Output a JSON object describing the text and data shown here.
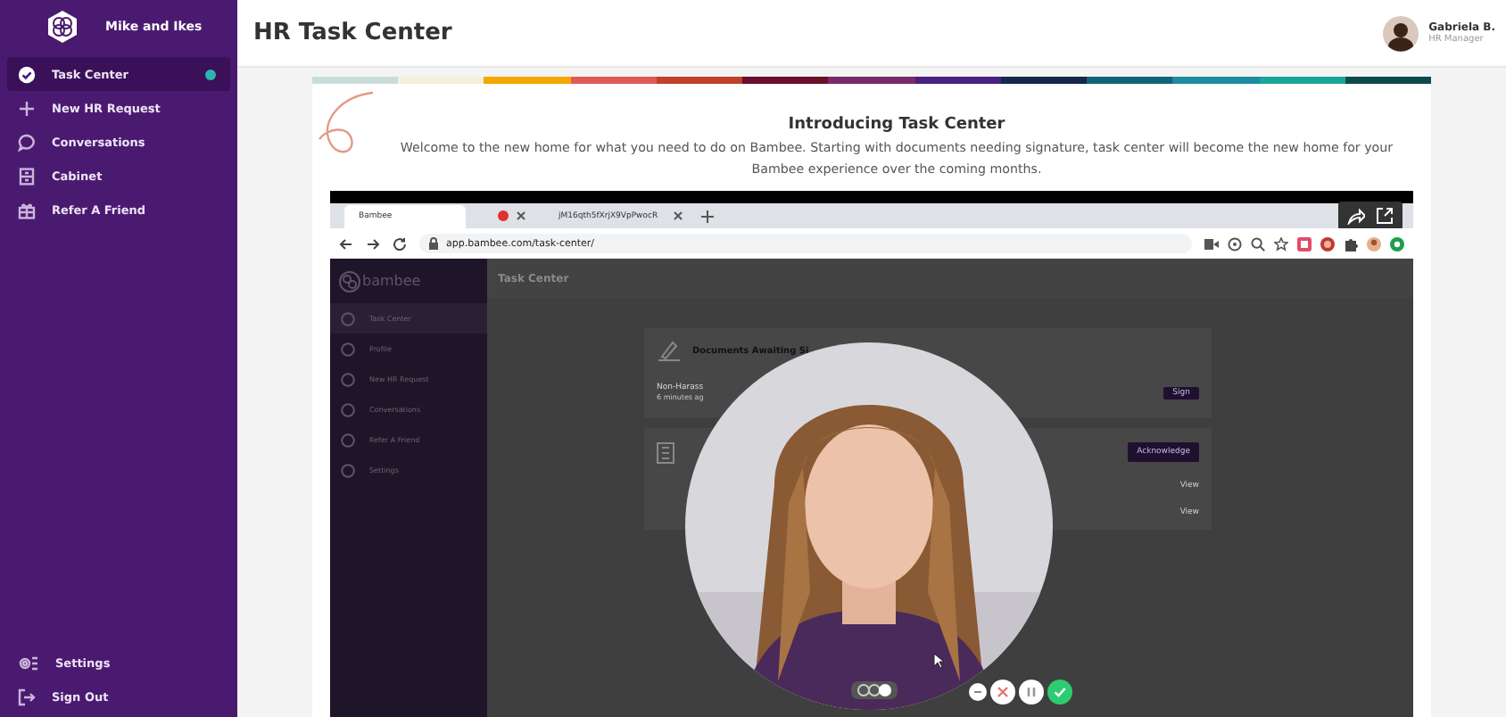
{
  "sidebar": {
    "brand": "Mike and Ikes",
    "items": [
      {
        "label": "Task Center",
        "kind": "check",
        "selected": true,
        "badge": true
      },
      {
        "label": "New HR Request",
        "kind": "plus",
        "selected": false,
        "badge": false
      },
      {
        "label": "Conversations",
        "kind": "chat",
        "selected": false,
        "badge": false
      },
      {
        "label": "Cabinet",
        "kind": "cabinet",
        "selected": false,
        "badge": false
      },
      {
        "label": "Refer A Friend",
        "kind": "gift",
        "selected": false,
        "badge": false
      }
    ],
    "footer_items": [
      {
        "label": "Settings",
        "kind": "gear"
      },
      {
        "label": "Sign Out",
        "kind": "exit"
      }
    ]
  },
  "header": {
    "title": "HR Task Center",
    "user": {
      "name": "Gabriela B.",
      "role": "HR Manager"
    }
  },
  "intro": {
    "stripe": [
      {
        "color": "#c9dcdc"
      },
      {
        "color": "#f5f0dc"
      },
      {
        "color": "#f5a800"
      },
      {
        "color": "#e05a5a"
      },
      {
        "color": "#c0402a"
      },
      {
        "color": "#6a0f2a"
      },
      {
        "color": "#7a2a6a"
      },
      {
        "color": "#4a2080"
      },
      {
        "color": "#14284a"
      },
      {
        "color": "#0f6478"
      },
      {
        "color": "#1e8ca0"
      },
      {
        "color": "#1aa59a"
      },
      {
        "color": "#0f4a4a"
      }
    ],
    "title": "Introducing Task Center",
    "text": "Welcome to the new home for what you need to do on Bambee. Starting with documents needing signature, task center will become the new home for your Bambee experience over the coming months."
  },
  "recording": {
    "browser": {
      "tabs": [
        {
          "label": "Bambee",
          "selected": true,
          "recording": true
        },
        {
          "label": "jM16qth5fXrjX9VpPwocR",
          "selected": false,
          "recording": false
        }
      ],
      "url": "app.bambee.com/task-center/"
    },
    "app": {
      "logo": "bambee",
      "page_title": "Task Center",
      "nav": [
        {
          "label": "Task Center",
          "selected": true
        },
        {
          "label": "Profile",
          "selected": false
        },
        {
          "label": "New HR Request",
          "selected": false
        },
        {
          "label": "Conversations",
          "selected": false
        },
        {
          "label": "Refer A Friend",
          "selected": false
        },
        {
          "label": "Settings",
          "selected": false
        }
      ],
      "documents_title": "Documents Awaiting Si",
      "document": {
        "name": "Non-Harass",
        "time": "6 minutes ag",
        "action": "Sign"
      },
      "acknowledge": "Acknowledge",
      "rows": [
        {
          "action": "View"
        },
        {
          "action": "View"
        }
      ]
    },
    "camera_toggle": {
      "on": true
    }
  }
}
